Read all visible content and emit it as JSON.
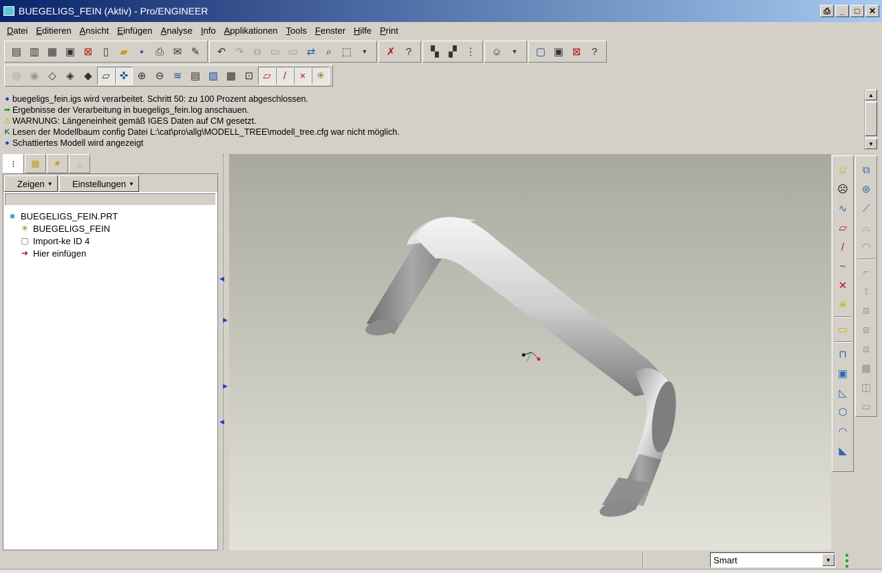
{
  "window": {
    "title": "BUEGELIGS_FEIN (Aktiv) - Pro/ENGINEER",
    "app_icon": "proe-part-icon",
    "buttons": [
      "print-icon",
      "minimize-icon",
      "maximize-icon",
      "close-icon"
    ]
  },
  "menu": [
    "Datei",
    "Editieren",
    "Ansicht",
    "Einfügen",
    "Analyse",
    "Info",
    "Applikationen",
    "Tools",
    "Fenster",
    "Hilfe",
    "Print"
  ],
  "messages": [
    {
      "icon": "info-dot-icon",
      "text": "buegeligs_fein.igs wird verarbeitet. Schritt 50:  zu 100 Prozent abgeschlossen."
    },
    {
      "icon": "green-arrow-icon",
      "text": "Ergebnisse der Verarbeitung in buegeligs_fein.log anschauen."
    },
    {
      "icon": "warning-icon",
      "text": "WARNUNG: Längeneinheit gemäß IGES Daten auf CM gesetzt."
    },
    {
      "icon": "k-icon",
      "text": "Lesen der Modellbaum config Datei L:\\cat\\pro\\allg\\MODELL_TREE\\modell_tree.cfg war nicht möglich."
    },
    {
      "icon": "info-dot-icon",
      "text": "Schattiertes Modell wird angezeigt"
    }
  ],
  "panel": {
    "tabs": [
      "model-tree-icon",
      "layers-icon",
      "favorites-icon",
      "connections-icon"
    ],
    "buttons": [
      {
        "label": "Zeigen"
      },
      {
        "label": "Einstellungen"
      }
    ],
    "tree": {
      "root": "BUEGELIGS_FEIN.PRT",
      "children": [
        {
          "icon": "csys-icon",
          "label": "BUEGELIGS_FEIN"
        },
        {
          "icon": "import-feature-icon",
          "label": "Import-ke ID 4"
        },
        {
          "icon": "insert-here-icon",
          "label": "Hier einfügen"
        }
      ]
    }
  },
  "statusbar": {
    "filter_value": "Smart"
  },
  "colors": {
    "title_start": "#0a246a",
    "title_end": "#a6caf0",
    "background": "#d4d0c8"
  }
}
